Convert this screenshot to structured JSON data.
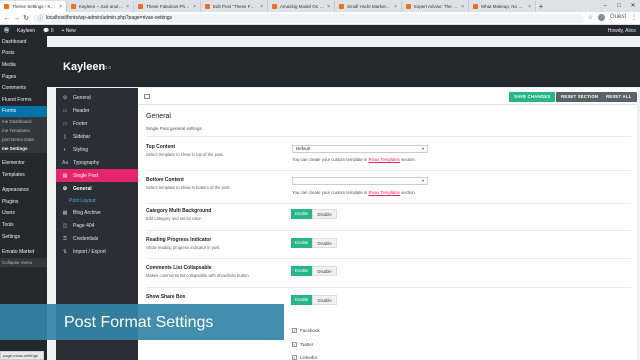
{
  "browser": {
    "tabs": [
      {
        "title": "Theme Settings ‹ Kayleen"
      },
      {
        "title": "Kayleen – Just another W"
      },
      {
        "title": "These Fabulous Photos H"
      },
      {
        "title": "Edit Post \"These Fabulous"
      },
      {
        "title": "Amazing Model On Site"
      },
      {
        "title": "Small Yacht Market Affect"
      },
      {
        "title": "Expert Advise: The Best C"
      },
      {
        "title": "What Makeup, No Matter"
      }
    ],
    "url": "localhost/fonts/wp-admin/admin.php?page=rivax-settings",
    "user_label": "Guest"
  },
  "admin_bar": {
    "site_name": "Kayleen",
    "comments_count": "0",
    "new_label": "New",
    "howdy": "Howdy, Alice"
  },
  "wp_menu": [
    {
      "label": "Dashboard",
      "type": "item"
    },
    {
      "label": "Posts",
      "type": "item"
    },
    {
      "label": "Media",
      "type": "item"
    },
    {
      "label": "Pages",
      "type": "item"
    },
    {
      "label": "Comments",
      "type": "item"
    },
    {
      "label": "Fluent Forms",
      "type": "item"
    },
    {
      "label": "Forms",
      "type": "active"
    },
    {
      "label": "me Dashboard",
      "type": "sub"
    },
    {
      "label": "me Templates",
      "type": "sub"
    },
    {
      "label": "port Demo Data",
      "type": "sub"
    },
    {
      "label": "me Settings",
      "type": "subbold"
    },
    {
      "label": "Elementor",
      "type": "item"
    },
    {
      "label": "Templates",
      "type": "item"
    },
    {
      "label": "Appearance",
      "type": "item"
    },
    {
      "label": "Plugins",
      "type": "item"
    },
    {
      "label": "Users",
      "type": "item"
    },
    {
      "label": "Tools",
      "type": "item"
    },
    {
      "label": "Settings",
      "type": "item"
    },
    {
      "label": "Envato Market",
      "type": "item"
    },
    {
      "label": "Collapse menu",
      "type": "sub"
    }
  ],
  "theme": {
    "name": "Kayleen",
    "version": "1.3.0"
  },
  "settings_nav": [
    {
      "label": "General",
      "icon": "⚙",
      "state": ""
    },
    {
      "label": "Header",
      "icon": "▭",
      "state": ""
    },
    {
      "label": "Footer",
      "icon": "▭",
      "state": ""
    },
    {
      "label": "Sidebar",
      "icon": "▯",
      "state": ""
    },
    {
      "label": "Styling",
      "icon": "◐",
      "state": ""
    },
    {
      "label": "Typography",
      "icon": "Aa",
      "state": ""
    },
    {
      "label": "Single Post",
      "icon": "▤",
      "state": "hot"
    },
    {
      "label": "General",
      "icon": "⚙",
      "state": "cur"
    },
    {
      "label": "Post Layout",
      "icon": "",
      "state": "link"
    },
    {
      "label": "Blog Archive",
      "icon": "▦",
      "state": ""
    },
    {
      "label": "Page 404",
      "icon": "◫",
      "state": ""
    },
    {
      "label": "Credentials",
      "icon": "⚿",
      "state": ""
    },
    {
      "label": "Import / Export",
      "icon": "⇅",
      "state": ""
    }
  ],
  "toolbar": {
    "save": "SAVE CHANGES",
    "reset_section": "RESET SECTION",
    "reset_all": "RESET ALL"
  },
  "section": {
    "title": "General",
    "subtitle": "Single Post general settings"
  },
  "settings": {
    "top_content": {
      "label": "Top Content",
      "desc": "Select template to show in top of the post.",
      "value": "Default",
      "hint_pre": "You can create your custom template in ",
      "hint_link": "Rivax Templates",
      "hint_post": " section."
    },
    "bottom_content": {
      "label": "Bottom Content",
      "desc": "Select template to show in bottom of the post.",
      "value": "",
      "hint_pre": "You can create your custom template in ",
      "hint_link": "Rivax Templates",
      "hint_post": " section."
    },
    "multi_background": {
      "label": "Category Multi Background",
      "desc": "Edit category and set its color."
    },
    "reading_progress": {
      "label": "Reading Progress Indicator",
      "desc": "Show reading progress indicator in post."
    },
    "comments_collapsable": {
      "label": "Comments List Collapsable",
      "desc": "Makes comments list collapsable with show/hide button."
    },
    "share_box": {
      "label": "Show Share Box",
      "desc": ""
    },
    "enable": "Enable",
    "disable": "Disable",
    "share_options": [
      "Facebook",
      "Twitter",
      "LinkedIn"
    ]
  },
  "banner": {
    "text": "Post Format Settings"
  },
  "status": {
    "text": "page=rivax-settings"
  }
}
